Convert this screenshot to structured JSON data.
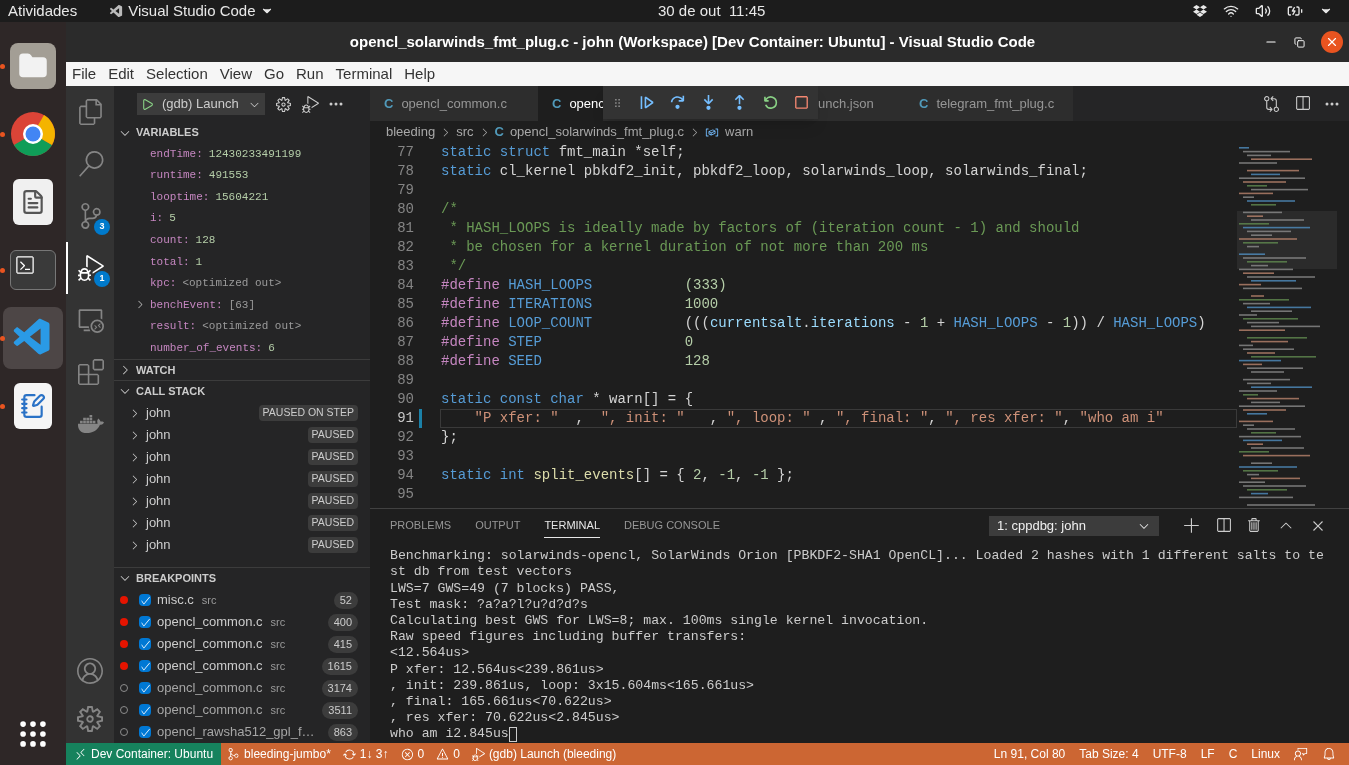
{
  "top_bar": {
    "activities": "Atividades",
    "app": "Visual Studio Code",
    "clock": "30 de out  11:45"
  },
  "dock": [
    {
      "kind": "files",
      "running": true,
      "selected": false
    },
    {
      "kind": "browser",
      "running": true,
      "selected": false
    },
    {
      "kind": "document",
      "running": false,
      "selected": false
    },
    {
      "kind": "terminal",
      "running": true,
      "selected": false
    },
    {
      "kind": "code",
      "running": true,
      "selected": true
    },
    {
      "kind": "editor",
      "running": true,
      "selected": false
    }
  ],
  "window": {
    "title": "opencl_solarwinds_fmt_plug.c - john (Workspace) [Dev Container: Ubuntu] - Visual Studio Code"
  },
  "menu": [
    "File",
    "Edit",
    "Selection",
    "View",
    "Go",
    "Run",
    "Terminal",
    "Help"
  ],
  "activity_bar": [
    {
      "kind": "explorer",
      "selected": false
    },
    {
      "kind": "search",
      "selected": false
    },
    {
      "kind": "source_control",
      "badge": "3",
      "selected": false
    },
    {
      "kind": "debug",
      "badge": "1",
      "selected": true
    },
    {
      "kind": "remote",
      "selected": false
    },
    {
      "kind": "extensions",
      "selected": false
    },
    {
      "kind": "docker",
      "selected": false
    }
  ],
  "activity_bar_bottom": [
    {
      "kind": "account"
    },
    {
      "kind": "settings"
    }
  ],
  "launch_config": "(gdb) Launch",
  "variables": {
    "title": "VARIABLES",
    "expanded": true,
    "items": [
      {
        "name": "endTime:",
        "value": "12430233491199",
        "kind": "number",
        "expandable": false
      },
      {
        "name": "runtime:",
        "value": "491553",
        "kind": "number",
        "expandable": false
      },
      {
        "name": "looptime:",
        "value": "15604221",
        "kind": "number",
        "expandable": false
      },
      {
        "name": "i:",
        "value": "5",
        "kind": "number",
        "expandable": false
      },
      {
        "name": "count:",
        "value": "128",
        "kind": "number",
        "expandable": false
      },
      {
        "name": "total:",
        "value": "1",
        "kind": "number",
        "expandable": false
      },
      {
        "name": "kpc:",
        "value": "<optimized out>",
        "kind": "info",
        "expandable": false
      },
      {
        "name": "benchEvent:",
        "value": "[63]",
        "kind": "info",
        "expandable": true
      },
      {
        "name": "result:",
        "value": "<optimized out>",
        "kind": "info",
        "expandable": false
      },
      {
        "name": "number_of_events:",
        "value": "6",
        "kind": "number",
        "expandable": false
      }
    ]
  },
  "watch": {
    "title": "WATCH",
    "expanded": false
  },
  "call_stack": {
    "title": "CALL STACK",
    "expanded": true,
    "items": [
      {
        "name": "john",
        "status": "PAUSED ON STEP"
      },
      {
        "name": "john",
        "status": "PAUSED"
      },
      {
        "name": "john",
        "status": "PAUSED"
      },
      {
        "name": "john",
        "status": "PAUSED"
      },
      {
        "name": "john",
        "status": "PAUSED"
      },
      {
        "name": "john",
        "status": "PAUSED"
      },
      {
        "name": "john",
        "status": "PAUSED"
      }
    ]
  },
  "breakpoints": {
    "title": "BREAKPOINTS",
    "expanded": true,
    "items": [
      {
        "file": "misc.c",
        "path": "src",
        "line": "52",
        "verified": true,
        "checked": true
      },
      {
        "file": "opencl_common.c",
        "path": "src",
        "line": "400",
        "verified": true,
        "checked": true
      },
      {
        "file": "opencl_common.c",
        "path": "src",
        "line": "415",
        "verified": true,
        "checked": true
      },
      {
        "file": "opencl_common.c",
        "path": "src",
        "line": "1615",
        "verified": true,
        "checked": true
      },
      {
        "file": "opencl_common.c",
        "path": "src",
        "line": "3174",
        "verified": false,
        "checked": true
      },
      {
        "file": "opencl_common.c",
        "path": "src",
        "line": "3511",
        "verified": false,
        "checked": true
      },
      {
        "file": "opencl_rawsha512_gpl_f…",
        "line": "863",
        "verified": false,
        "checked": true
      }
    ]
  },
  "tabs": [
    {
      "label": "opencl_common.c",
      "icon": "C",
      "selected": false
    },
    {
      "label": "openc",
      "icon": "C",
      "selected": true
    },
    {
      "label": "unch.json",
      "selected": false
    },
    {
      "label": "telegram_fmt_plug.c",
      "icon": "C",
      "selected": false
    }
  ],
  "breadcrumbs": [
    {
      "text": "bleeding",
      "kind": "folder"
    },
    {
      "text": "src",
      "kind": "folder"
    },
    {
      "text": "opencl_solarwinds_fmt_plug.c",
      "kind": "c_file",
      "icon": "C"
    },
    {
      "text": "warn",
      "kind": "variable"
    }
  ],
  "debug_toolbar": [
    {
      "kind": "continue"
    },
    {
      "kind": "step_over"
    },
    {
      "kind": "step_into"
    },
    {
      "kind": "step_out"
    },
    {
      "kind": "restart"
    },
    {
      "kind": "stop"
    }
  ],
  "code": [
    {
      "number": "77",
      "current": false,
      "tokens": [
        {
          "kind": "kw",
          "text": "static struct "
        },
        {
          "kind": "plain",
          "text": "fmt_main *self;"
        }
      ]
    },
    {
      "number": "78",
      "current": false,
      "tokens": [
        {
          "kind": "kw",
          "text": "static "
        },
        {
          "kind": "plain",
          "text": "cl_kernel pbkdf2_init, pbkdf2_loop, solarwinds_loop, solarwinds_final;"
        }
      ]
    },
    {
      "number": "79",
      "current": false
    },
    {
      "number": "80",
      "current": false,
      "tokens": [
        {
          "kind": "comment",
          "text": "/*"
        }
      ]
    },
    {
      "number": "81",
      "current": false,
      "tokens": [
        {
          "kind": "comment",
          "text": " * HASH_LOOPS is ideally made by factors of (iteration count - 1) and should"
        }
      ]
    },
    {
      "number": "82",
      "current": false,
      "tokens": [
        {
          "kind": "comment",
          "text": " * be chosen for a kernel duration of not more than 200 ms"
        }
      ]
    },
    {
      "number": "83",
      "current": false,
      "tokens": [
        {
          "kind": "comment",
          "text": " */"
        }
      ]
    },
    {
      "number": "84",
      "current": false,
      "tokens": [
        {
          "kind": "directive",
          "text": "#define "
        },
        {
          "kind": "macro",
          "text": "HASH_LOOPS           "
        },
        {
          "kind": "number",
          "text": "(333)"
        }
      ]
    },
    {
      "number": "85",
      "current": false,
      "tokens": [
        {
          "kind": "directive",
          "text": "#define "
        },
        {
          "kind": "macro",
          "text": "ITERATIONS           "
        },
        {
          "kind": "number",
          "text": "1000"
        }
      ]
    },
    {
      "number": "86",
      "current": false,
      "tokens": [
        {
          "kind": "directive",
          "text": "#define "
        },
        {
          "kind": "macro",
          "text": "LOOP_COUNT           "
        },
        {
          "kind": "plain",
          "text": "((("
        },
        {
          "kind": "var",
          "text": "currentsalt"
        },
        {
          "kind": "plain",
          "text": "."
        },
        {
          "kind": "var",
          "text": "iterations"
        },
        {
          "kind": "plain",
          "text": " - "
        },
        {
          "kind": "number",
          "text": "1"
        },
        {
          "kind": "plain",
          "text": " + "
        },
        {
          "kind": "macro",
          "text": "HASH_LOOPS"
        },
        {
          "kind": "plain",
          "text": " - "
        },
        {
          "kind": "number",
          "text": "1"
        },
        {
          "kind": "plain",
          "text": ")) / "
        },
        {
          "kind": "macro",
          "text": "HASH_LOOPS"
        },
        {
          "kind": "plain",
          "text": ")"
        }
      ]
    },
    {
      "number": "87",
      "current": false,
      "tokens": [
        {
          "kind": "directive",
          "text": "#define "
        },
        {
          "kind": "macro",
          "text": "STEP                 "
        },
        {
          "kind": "number",
          "text": "0"
        }
      ]
    },
    {
      "number": "88",
      "current": false,
      "tokens": [
        {
          "kind": "directive",
          "text": "#define "
        },
        {
          "kind": "macro",
          "text": "SEED                 "
        },
        {
          "kind": "number",
          "text": "128"
        }
      ]
    },
    {
      "number": "89",
      "current": false
    },
    {
      "number": "90",
      "current": false,
      "tokens": [
        {
          "kind": "kw",
          "text": "static const char"
        },
        {
          "kind": "plain",
          "text": " * warn[] = {"
        }
      ]
    },
    {
      "number": "91",
      "current": true,
      "tokens": [
        {
          "kind": "string",
          "text": "    \"P xfer: \""
        },
        {
          "kind": "plain",
          "text": "  ,  "
        },
        {
          "kind": "string",
          "text": "\", init: \""
        },
        {
          "kind": "plain",
          "text": "   , "
        },
        {
          "kind": "string",
          "text": "\", loop: \""
        },
        {
          "kind": "plain",
          "text": " , "
        },
        {
          "kind": "string",
          "text": "\", final: \""
        },
        {
          "kind": "plain",
          "text": ", "
        },
        {
          "kind": "string",
          "text": "\", res xfer: \""
        },
        {
          "kind": "plain",
          "text": ", "
        },
        {
          "kind": "string",
          "text": "\"who am i\""
        }
      ]
    },
    {
      "number": "92",
      "current": false,
      "tokens": [
        {
          "kind": "plain",
          "text": "};"
        }
      ]
    },
    {
      "number": "93",
      "current": false
    },
    {
      "number": "94",
      "current": false,
      "tokens": [
        {
          "kind": "kw",
          "text": "static int "
        },
        {
          "kind": "func",
          "text": "split_events"
        },
        {
          "kind": "plain",
          "text": "[] = { "
        },
        {
          "kind": "number",
          "text": "2"
        },
        {
          "kind": "plain",
          "text": ", "
        },
        {
          "kind": "number",
          "text": "-1"
        },
        {
          "kind": "plain",
          "text": ", "
        },
        {
          "kind": "number",
          "text": "-1"
        },
        {
          "kind": "plain",
          "text": " };"
        }
      ]
    },
    {
      "number": "95",
      "current": false
    }
  ],
  "panel": {
    "tabs": [
      {
        "label": "PROBLEMS",
        "selected": false
      },
      {
        "label": "OUTPUT",
        "selected": false
      },
      {
        "label": "TERMINAL",
        "selected": true
      },
      {
        "label": "DEBUG CONSOLE",
        "selected": false
      }
    ],
    "terminal_select": "1: cppdbg: john",
    "terminal_lines": [
      "Benchmarking: solarwinds-opencl, SolarWinds Orion [PBKDF2-SHA1 OpenCL]... Loaded 2 hashes with 1 different salts to te",
      "st db from test vectors",
      "LWS=7 GWS=49 (7 blocks) PASS,",
      "Test mask: ?a?a?l?u?d?d?s",
      "Calculating best GWS for LWS=8; max. 100ms single kernel invocation.",
      "Raw speed figures including buffer transfers:",
      "<12.564us>",
      "P xfer: 12.564us<239.861us>",
      ", init: 239.861us, loop: 3x15.604ms<165.661us>",
      ", final: 165.661us<70.622us>",
      ", res xfer: 70.622us<2.845us>",
      "who am i2.845us"
    ]
  },
  "status_bar": {
    "remote": "Dev Container: Ubuntu",
    "left": [
      {
        "kind": "branch",
        "text": "bleeding-jumbo*"
      },
      {
        "kind": "sync",
        "text": "1↓ 3↑"
      },
      {
        "kind": "errors",
        "text": "0"
      },
      {
        "kind": "warnings",
        "text": "0"
      },
      {
        "kind": "debug",
        "text": "(gdb) Launch (bleeding)"
      }
    ],
    "right": [
      {
        "kind": "text",
        "text": "Ln 91, Col 80"
      },
      {
        "kind": "text",
        "text": "Tab Size: 4"
      },
      {
        "kind": "text",
        "text": "UTF-8"
      },
      {
        "kind": "text",
        "text": "LF"
      },
      {
        "kind": "text",
        "text": "C"
      },
      {
        "kind": "text",
        "text": "Linux"
      },
      {
        "kind": "feedback"
      },
      {
        "kind": "bell"
      }
    ]
  }
}
